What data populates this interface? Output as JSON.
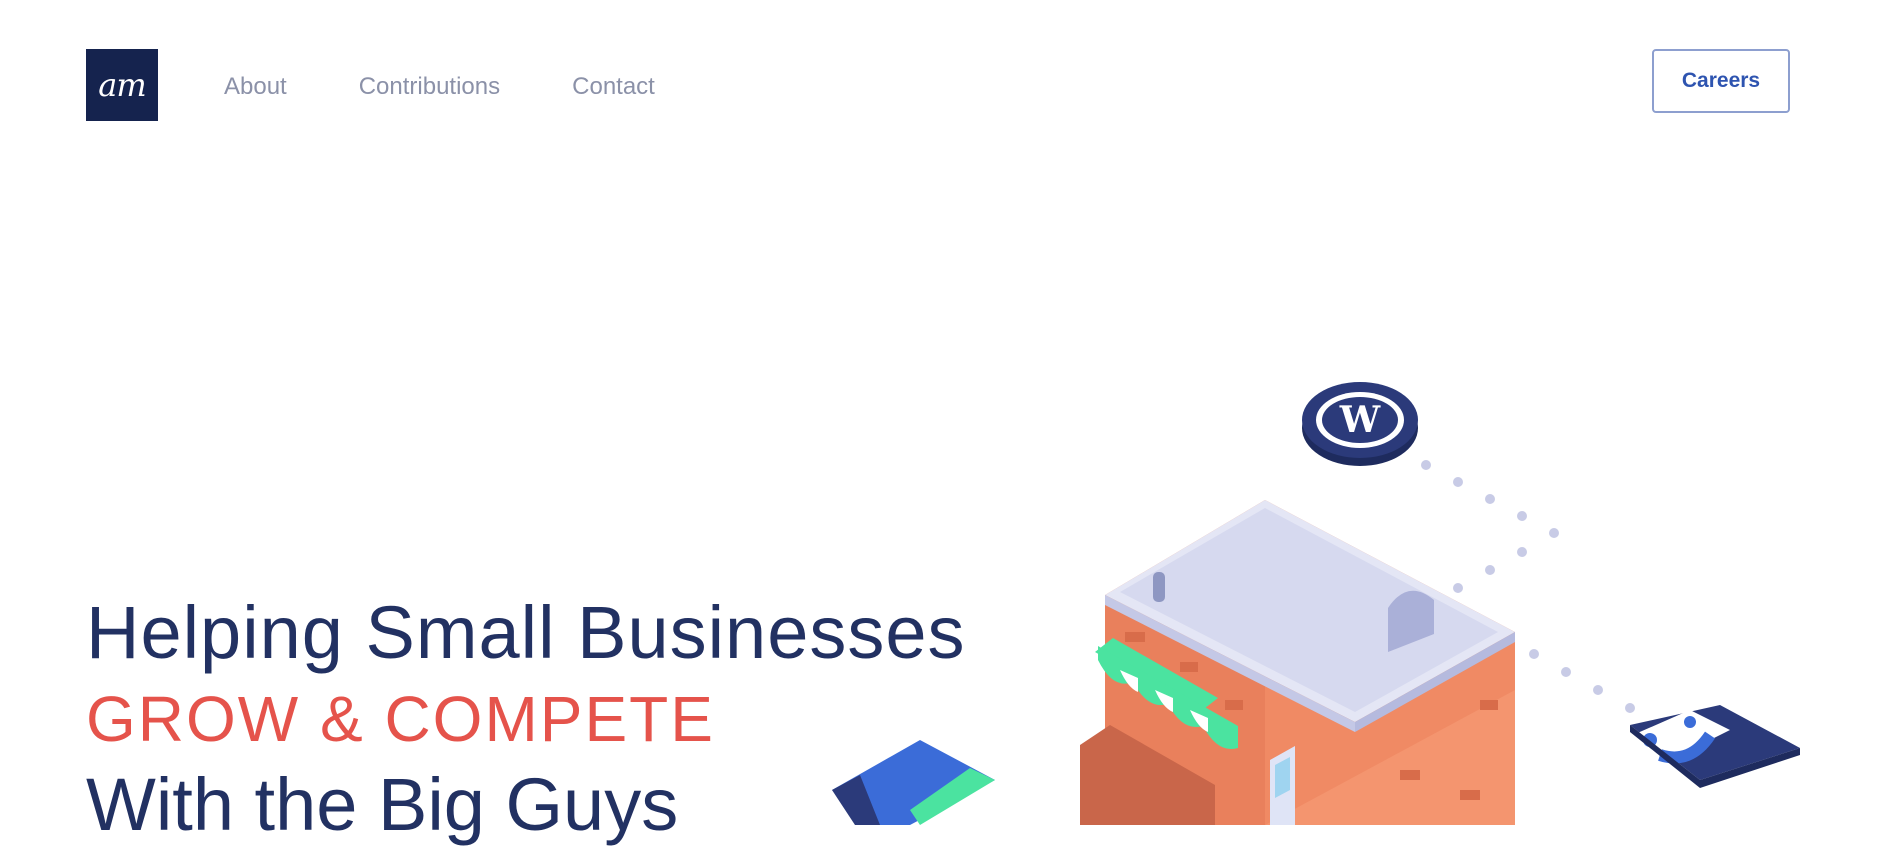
{
  "brand": {
    "logo_text": "am",
    "primary": "#15234e",
    "accent": "#e5534b",
    "link": "#2e54b0"
  },
  "nav": {
    "items": [
      {
        "label": "About"
      },
      {
        "label": "Contributions"
      },
      {
        "label": "Contact"
      }
    ],
    "cta_label": "Careers"
  },
  "hero": {
    "line1": "Helping Small Businesses",
    "line2": "GROW & COMPETE",
    "line3": "With the Big Guys"
  },
  "illustration": {
    "icons": [
      "wordpress-icon",
      "storefront-illustration",
      "map-icon",
      "envelope-icon"
    ]
  }
}
